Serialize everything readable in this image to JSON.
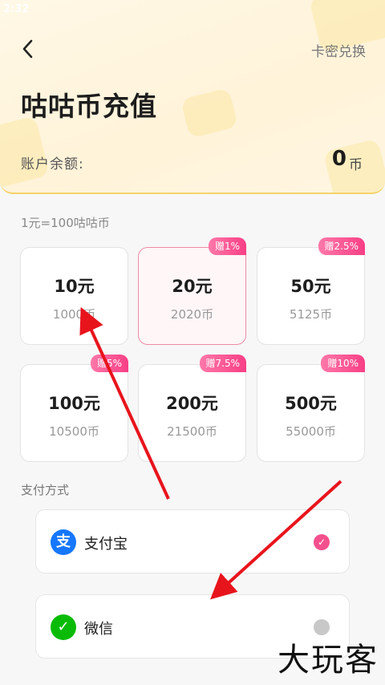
{
  "status": {
    "time": "2:32"
  },
  "header": {
    "title": "咕咕币充值",
    "card_redeem": "卡密兑换",
    "balance_label": "账户余额:",
    "balance_value": "0",
    "balance_unit": "币"
  },
  "rate_text": "1元=100咕咕币",
  "packages": [
    {
      "yuan": "10元",
      "coins": "1000币",
      "bonus": "",
      "selected": false
    },
    {
      "yuan": "20元",
      "coins": "2020币",
      "bonus": "赠1%",
      "selected": true
    },
    {
      "yuan": "50元",
      "coins": "5125币",
      "bonus": "赠2.5%",
      "selected": false
    },
    {
      "yuan": "100元",
      "coins": "10500币",
      "bonus": "赠5%",
      "selected": false
    },
    {
      "yuan": "200元",
      "coins": "21500币",
      "bonus": "赠7.5%",
      "selected": false
    },
    {
      "yuan": "500元",
      "coins": "55000币",
      "bonus": "赠10%",
      "selected": false
    }
  ],
  "payment": {
    "label": "支付方式",
    "methods": [
      {
        "name": "支付宝",
        "icon": "alipay-icon",
        "icon_char": "支",
        "color": "#1677ff",
        "selected": true
      },
      {
        "name": "微信",
        "icon": "wechat-icon",
        "icon_char": "✓",
        "color": "#09bb07",
        "selected": false
      }
    ]
  },
  "watermark": "大玩客",
  "colors": {
    "accent": "#f4508e",
    "annotation_arrow": "#e8141c"
  }
}
